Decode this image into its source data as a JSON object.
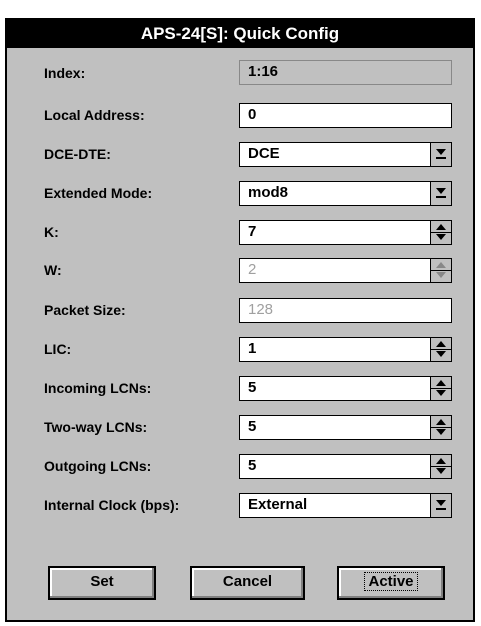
{
  "window": {
    "title": "APS-24[S]: Quick Config"
  },
  "fields": [
    {
      "label": "Index:",
      "value": "1:16"
    },
    {
      "label": "Local Address:",
      "value": "0"
    },
    {
      "label": "DCE-DTE:",
      "value": "DCE"
    },
    {
      "label": "Extended Mode:",
      "value": "mod8"
    },
    {
      "label": "K:",
      "value": "7"
    },
    {
      "label": "W:",
      "value": "2"
    },
    {
      "label": "Packet Size:",
      "value": "128"
    },
    {
      "label": "LIC:",
      "value": "1"
    },
    {
      "label": "Incoming LCNs:",
      "value": "5"
    },
    {
      "label": "Two-way LCNs:",
      "value": "5"
    },
    {
      "label": "Outgoing LCNs:",
      "value": "5"
    },
    {
      "label": "Internal Clock (bps):",
      "value": "External"
    }
  ],
  "buttons": {
    "set": "Set",
    "cancel": "Cancel",
    "active": "Active"
  }
}
